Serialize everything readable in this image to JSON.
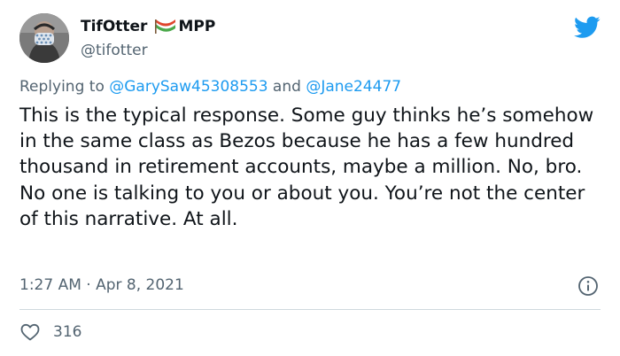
{
  "author": {
    "display_name": "TifOtter",
    "name_suffix": "MPP",
    "handle": "@tifotter"
  },
  "reply": {
    "prefix": "Replying to ",
    "mention_1": "@GarySaw45308553",
    "conjunction": " and ",
    "mention_2": "@Jane24477"
  },
  "tweet": {
    "text": "This is the typical response. Some guy thinks he’s somehow in the same class as Bezos because he has a few hundred thousand in retirement accounts, maybe a million. No, bro. No one is talking to you or about you. You’re not the center of this narrative. At all.",
    "time": "1:27 AM",
    "separator": " · ",
    "date": "Apr 8, 2021"
  },
  "engagement": {
    "likes": "316"
  },
  "icons": {
    "brand": "twitter-bird-icon",
    "info": "info-icon",
    "like": "heart-icon",
    "name_emoji": "flag-emoji-icon"
  },
  "colors": {
    "brand_blue": "#1d9bf0",
    "text_primary": "#0f1419",
    "text_secondary": "#536471",
    "divider": "#cfd9de"
  }
}
